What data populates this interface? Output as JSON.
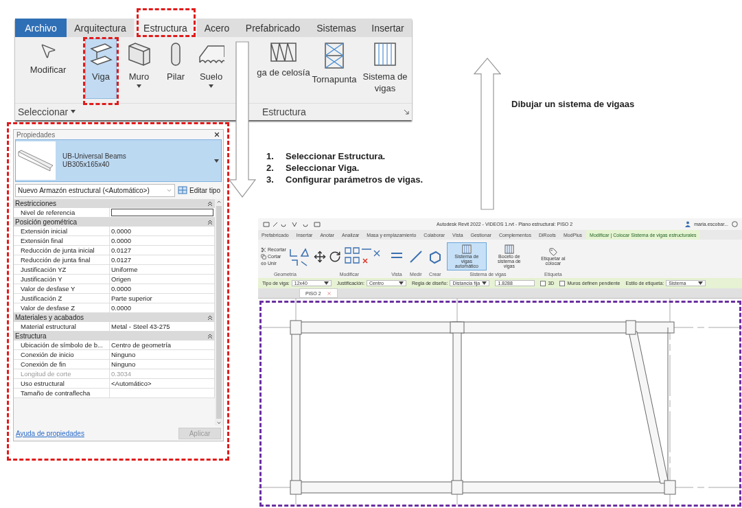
{
  "ribbon": {
    "tabs": [
      {
        "label": "Archivo",
        "kind": "file",
        "selected": false
      },
      {
        "label": "Arquitectura",
        "kind": "tab",
        "selected": false
      },
      {
        "label": "Estructura",
        "kind": "tab",
        "selected": true
      },
      {
        "label": "Acero",
        "kind": "tab",
        "selected": false
      },
      {
        "label": "Prefabricado",
        "kind": "tab",
        "selected": false
      },
      {
        "label": "Sistemas",
        "kind": "tab",
        "selected": false
      },
      {
        "label": "Insertar",
        "kind": "tab",
        "selected": false
      }
    ],
    "tools": [
      {
        "label": "Modificar",
        "kind": "pointer",
        "has_menu": false,
        "selected": false
      },
      {
        "label": "Viga",
        "kind": "beam",
        "has_menu": false,
        "selected": true
      },
      {
        "label": "Muro",
        "kind": "wall",
        "has_menu": true,
        "selected": false
      },
      {
        "label": "Pilar",
        "kind": "column",
        "has_menu": false,
        "selected": false
      },
      {
        "label": "Suelo",
        "kind": "floor",
        "has_menu": true,
        "selected": false
      },
      {
        "label": "ga de celosía",
        "kind": "truss",
        "has_menu": false,
        "selected": false
      },
      {
        "label": "Tornapunta",
        "kind": "brace",
        "has_menu": false,
        "selected": false
      },
      {
        "label": "Sistema de vigas",
        "kind": "beam-system",
        "has_menu": false,
        "selected": false
      }
    ],
    "panels": [
      {
        "label": "Seleccionar",
        "has_menu": true
      },
      {
        "label": "Estructura",
        "has_menu": false
      }
    ]
  },
  "properties": {
    "title": "Propiedades",
    "type_family": "UB-Universal Beams",
    "type_name": "UB305x165x40",
    "instance": "Nuevo Armazón estructural (<Automático>)",
    "edit_type": "Editar tipo",
    "groups": [
      {
        "label": "Restricciones",
        "rows": [
          {
            "name": "Nivel de referencia",
            "kind": "input",
            "disabled": false
          }
        ]
      },
      {
        "label": "Posición geométrica",
        "rows": [
          {
            "name": "Extensión inicial",
            "value": "0.0000",
            "kind": "text",
            "disabled": false
          },
          {
            "name": "Extensión final",
            "value": "0.0000",
            "kind": "text",
            "disabled": false
          },
          {
            "name": "Reducción de junta inicial",
            "value": "0.0127",
            "kind": "text",
            "disabled": false
          },
          {
            "name": "Reducción de junta final",
            "value": "0.0127",
            "kind": "text",
            "disabled": false
          },
          {
            "name": "Justificación YZ",
            "value": "Uniforme",
            "kind": "text",
            "disabled": false
          },
          {
            "name": "Justificación Y",
            "value": "Origen",
            "kind": "text",
            "disabled": false
          },
          {
            "name": "Valor de desfase Y",
            "value": "0.0000",
            "kind": "text",
            "disabled": false
          },
          {
            "name": "Justificación Z",
            "value": "Parte superior",
            "kind": "text",
            "disabled": false
          },
          {
            "name": "Valor de desfase Z",
            "value": "0.0000",
            "kind": "text",
            "disabled": false
          }
        ]
      },
      {
        "label": "Materiales y acabados",
        "rows": [
          {
            "name": "Material estructural",
            "value": "Metal - Steel 43-275",
            "kind": "text",
            "disabled": false
          }
        ]
      },
      {
        "label": "Estructura",
        "rows": [
          {
            "name": "Ubicación de símbolo de b...",
            "value": "Centro de geometría",
            "kind": "text",
            "disabled": false
          },
          {
            "name": "Conexión de inicio",
            "value": "Ninguno",
            "kind": "text",
            "disabled": false
          },
          {
            "name": "Conexión de fin",
            "value": "Ninguno",
            "kind": "text",
            "disabled": false
          },
          {
            "name": "Longitud de corte",
            "value": "0.3034",
            "kind": "text",
            "disabled": true
          },
          {
            "name": "Uso estructural",
            "value": "<Automático>",
            "kind": "text",
            "disabled": false
          },
          {
            "name": "Tamaño de contraflecha",
            "kind": "text",
            "disabled": false
          }
        ]
      }
    ],
    "help_link": "Ayuda de propiedades",
    "apply": {
      "label": "Aplicar",
      "disabled": true
    }
  },
  "steps": [
    "Seleccionar Estructura.",
    "Seleccionar Viga.",
    "Configurar parámetros de vigas."
  ],
  "step_numbers": [
    "1.",
    "2.",
    "3."
  ],
  "caption": "Dibujar un sistema de vigaas",
  "revit": {
    "title": "Autodesk Revit 2022 - VIDEOS 1.rvt - Plano estructural: PISO 2",
    "user": "maria.escobar...",
    "tabs": [
      {
        "label": "Prefabricado",
        "selected": false
      },
      {
        "label": "Insertar",
        "selected": false
      },
      {
        "label": "Anotar",
        "selected": false
      },
      {
        "label": "Analizar",
        "selected": false
      },
      {
        "label": "Masa y emplazamiento",
        "selected": false
      },
      {
        "label": "Colaborar",
        "selected": false
      },
      {
        "label": "Vista",
        "selected": false
      },
      {
        "label": "Gestionar",
        "selected": false
      },
      {
        "label": "Complementos",
        "selected": false
      },
      {
        "label": "DiRoots",
        "selected": false
      },
      {
        "label": "ModPlus",
        "selected": false
      },
      {
        "label": "Modificar | Colocar Sistema de vigas estructurales",
        "selected": true
      }
    ],
    "small_tools": [
      "Recortar",
      "Cortar",
      "Unir"
    ],
    "panels": [
      "Geometría",
      "Modificar",
      "Vista",
      "Medir",
      "Crear",
      "Sistema de vigas",
      "Etiqueta"
    ],
    "big_tools": [
      {
        "label": "Sistema de vigas automático",
        "selected": true
      },
      {
        "label": "Boceto de sistema de vigas",
        "selected": false
      },
      {
        "label": "Etiquetar al colocar",
        "selected": false
      }
    ],
    "options": [
      {
        "label": "Tipo de viga:",
        "value": "12x40",
        "kind": "select"
      },
      {
        "label": "Justificación:",
        "value": "Centro",
        "kind": "select"
      },
      {
        "label": "Regla de diseño:",
        "value": "Distancia fija",
        "kind": "select"
      },
      {
        "value": "1.8288",
        "kind": "input"
      },
      {
        "label": "3D",
        "kind": "checkbox",
        "checked": false
      },
      {
        "label": "Muros definen pendiente",
        "kind": "checkbox",
        "checked": false
      },
      {
        "label": "Estilo de etiqueta:",
        "value": "Sistema",
        "kind": "select"
      }
    ],
    "view_tabs": [
      {
        "label": "PISO 2",
        "selected": true
      }
    ]
  }
}
